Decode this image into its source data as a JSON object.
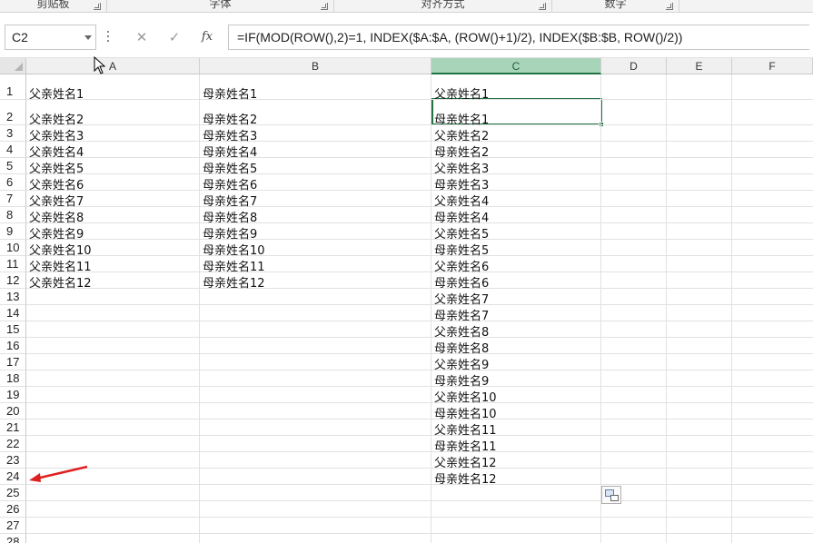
{
  "ribbon": {
    "groups": [
      {
        "label": "剪贴板"
      },
      {
        "label": "字体"
      },
      {
        "label": "对齐方式"
      },
      {
        "label": "数字"
      }
    ]
  },
  "formula_bar": {
    "name_box": "C2",
    "cancel_icon": "close-icon",
    "enter_icon": "check-icon",
    "fx_label": "fx",
    "formula": "=IF(MOD(ROW(),2)=1, INDEX($A:$A, (ROW()+1)/2), INDEX($B:$B, ROW()/2))"
  },
  "sheet": {
    "columns": [
      "A",
      "B",
      "C",
      "D",
      "E",
      "F"
    ],
    "selected_column": "C",
    "active_cell": "C2",
    "rows": [
      "1",
      "2",
      "3",
      "4",
      "5",
      "6",
      "7",
      "8",
      "9",
      "10",
      "11",
      "12",
      "13",
      "14",
      "15",
      "16",
      "17",
      "18",
      "19",
      "20",
      "21",
      "22",
      "23",
      "24",
      "25",
      "26",
      "27",
      "28"
    ],
    "col_a": [
      "父亲姓名1",
      "父亲姓名2",
      "父亲姓名3",
      "父亲姓名4",
      "父亲姓名5",
      "父亲姓名6",
      "父亲姓名7",
      "父亲姓名8",
      "父亲姓名9",
      "父亲姓名10",
      "父亲姓名11",
      "父亲姓名12"
    ],
    "col_b": [
      "母亲姓名1",
      "母亲姓名2",
      "母亲姓名3",
      "母亲姓名4",
      "母亲姓名5",
      "母亲姓名6",
      "母亲姓名7",
      "母亲姓名8",
      "母亲姓名9",
      "母亲姓名10",
      "母亲姓名11",
      "母亲姓名12"
    ],
    "col_c": [
      "父亲姓名1",
      "母亲姓名1",
      "父亲姓名2",
      "母亲姓名2",
      "父亲姓名3",
      "母亲姓名3",
      "父亲姓名4",
      "母亲姓名4",
      "父亲姓名5",
      "母亲姓名5",
      "父亲姓名6",
      "母亲姓名6",
      "父亲姓名7",
      "母亲姓名7",
      "父亲姓名8",
      "母亲姓名8",
      "父亲姓名9",
      "母亲姓名9",
      "父亲姓名10",
      "母亲姓名10",
      "父亲姓名11",
      "母亲姓名11",
      "父亲姓名12",
      "母亲姓名12"
    ]
  },
  "colors": {
    "accent": "#217346",
    "selected_header": "#a8d5ba",
    "annotation_arrow": "#e02020"
  }
}
